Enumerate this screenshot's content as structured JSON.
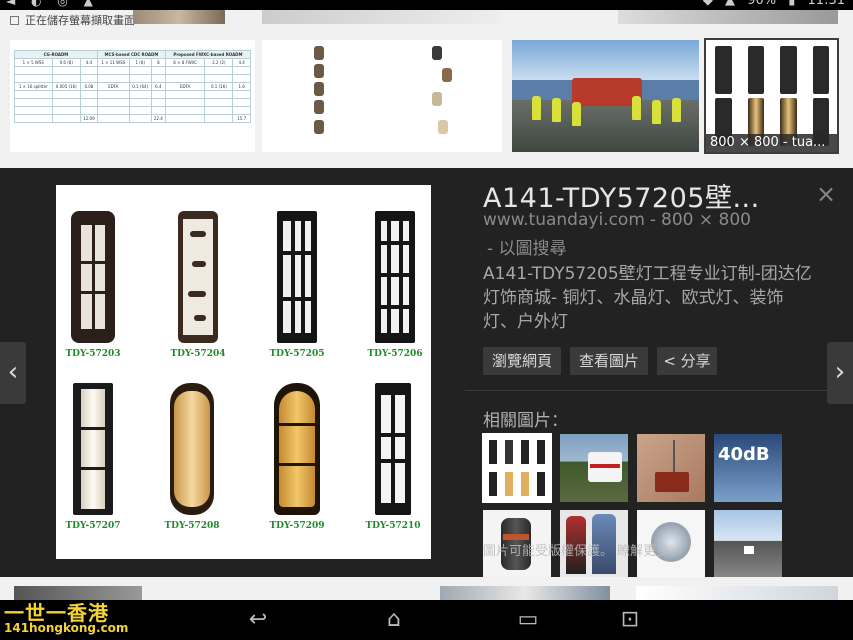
{
  "status_bar": {
    "notification_text": "正在儲存螢幕擷取畫面",
    "battery": "90%",
    "time": "11:31"
  },
  "top_results": {
    "thumbnail_table": {
      "headers": [
        "CG-ROADM",
        "MCS-based CDC ROADM",
        "Proposed FWXC-based ROADM"
      ],
      "rows": [
        [
          "1 × 5 WSS",
          "0.6 (8)",
          "4.4",
          "1 × 11 WSS",
          "1 (8)",
          "8",
          "8 × 8 FWXC",
          "2.2 (2)",
          "4.4"
        ],
        [
          "1 × 16 splitter",
          "0.005 (16)",
          "0.08",
          "EDFA",
          "0.1 (64)",
          "6.4",
          "EDFA",
          "0.1 (16)",
          "1.6"
        ],
        [
          "",
          "",
          "12.09",
          "",
          "",
          "22.4",
          "",
          "",
          "15.7"
        ]
      ]
    },
    "selected_thumbnail_caption": "800 × 800 - tua..."
  },
  "detail": {
    "title": "A141-TDY57205壁...",
    "source_domain": "www.tuandayi.com",
    "dimensions": "800 × 800",
    "search_by_image": "- 以圖搜尋",
    "description": "A141-TDY57205壁灯工程专业订制-团达亿灯饰商城- 铜灯、水晶灯、欧式灯、装饰灯、户外灯",
    "buttons": {
      "visit_page": "瀏覽網頁",
      "view_image": "查看圖片",
      "share": "< 分享"
    },
    "related_title": "相關圖片：",
    "related_watermark": "圖片可能受版權保護。 瞭解更多",
    "related_images": [
      {
        "name": "lamps",
        "selected": true,
        "label": ""
      },
      {
        "name": "ambulance",
        "selected": false,
        "label": ""
      },
      {
        "name": "radio-device",
        "selected": false,
        "label": ""
      },
      {
        "name": "sound-meter",
        "selected": false,
        "label": "40dB"
      },
      {
        "name": "camera-lens",
        "selected": false,
        "label": ""
      },
      {
        "name": "people",
        "selected": false,
        "label": ""
      },
      {
        "name": "watch",
        "selected": false,
        "label": ""
      },
      {
        "name": "highway",
        "selected": false,
        "label": ""
      }
    ]
  },
  "preview_image": {
    "products": [
      {
        "code": "TDY-57203",
        "style": "ornate-dark"
      },
      {
        "code": "TDY-57204",
        "style": "vine-frame"
      },
      {
        "code": "TDY-57205",
        "style": "grid-black"
      },
      {
        "code": "TDY-57206",
        "style": "grid-black-wide"
      },
      {
        "code": "TDY-57207",
        "style": "frame-white-glow"
      },
      {
        "code": "TDY-57208",
        "style": "cylinder-amber"
      },
      {
        "code": "TDY-57209",
        "style": "rounded-amber"
      },
      {
        "code": "TDY-57210",
        "style": "deco-black"
      }
    ]
  },
  "watermark": {
    "line1": "一世一香港",
    "line2": "141hongkong.com"
  },
  "colors": {
    "panel_bg": "#222222",
    "button_bg": "#3a3a3a",
    "product_code_green": "#1f8a2a",
    "watermark_yellow": "#f3d23a"
  }
}
